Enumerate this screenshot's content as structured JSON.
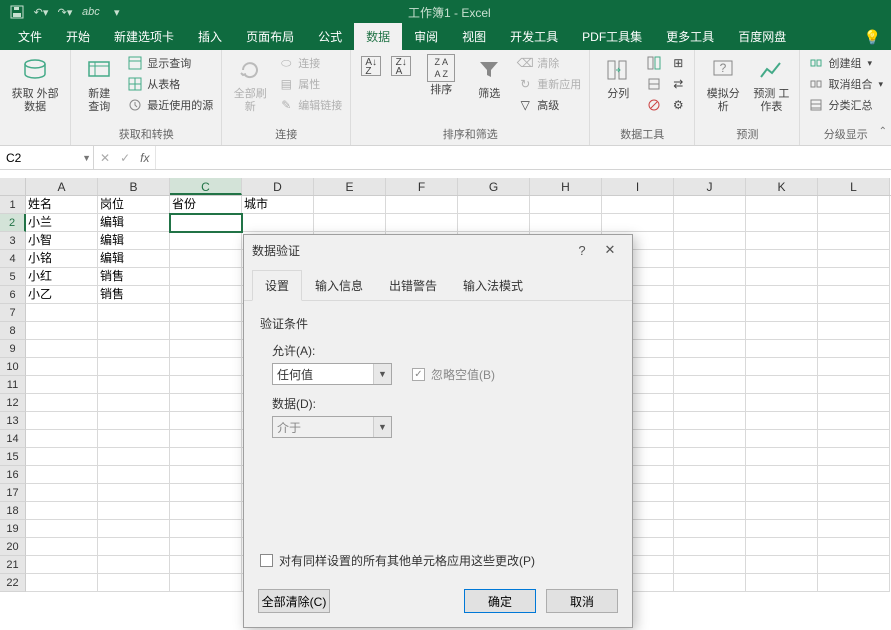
{
  "app": {
    "title": "工作簿1 - Excel"
  },
  "qat": {
    "save": "save-icon",
    "undo": "undo-icon",
    "redo": "redo-icon",
    "touch": "abc"
  },
  "tabs": {
    "items": [
      {
        "label": "文件"
      },
      {
        "label": "开始"
      },
      {
        "label": "新建选项卡"
      },
      {
        "label": "插入"
      },
      {
        "label": "页面布局"
      },
      {
        "label": "公式"
      },
      {
        "label": "数据"
      },
      {
        "label": "审阅"
      },
      {
        "label": "视图"
      },
      {
        "label": "开发工具"
      },
      {
        "label": "PDF工具集"
      },
      {
        "label": "更多工具"
      },
      {
        "label": "百度网盘"
      }
    ],
    "active_index": 6
  },
  "ribbon": {
    "g1": {
      "label": "获取\n外部数据"
    },
    "g2": {
      "label": "获取和转换",
      "newquery": "新建\n查询",
      "showq": "显示查询",
      "fromtable": "从表格",
      "recent": "最近使用的源"
    },
    "g3": {
      "label": "连接",
      "refresh": "全部刷新",
      "conn": "连接",
      "prop": "属性",
      "edit": "编辑链接"
    },
    "g4": {
      "label": "排序和筛选",
      "sort": "排序",
      "filter": "筛选",
      "clear": "清除",
      "reapply": "重新应用",
      "adv": "高级"
    },
    "g5": {
      "label": "数据工具",
      "textcol": "分列"
    },
    "g6": {
      "label": "预测",
      "whatif": "模拟分析",
      "forecast": "预测\n工作表"
    },
    "g7": {
      "label": "分级显示",
      "group": "创建组",
      "ungroup": "取消组合",
      "subtotal": "分类汇总"
    }
  },
  "namebox": "C2",
  "columns": [
    "A",
    "B",
    "C",
    "D",
    "E",
    "F",
    "G",
    "H",
    "I",
    "J",
    "K",
    "L"
  ],
  "active_col_index": 2,
  "active_row_index": 1,
  "data_rows": [
    [
      "姓名",
      "岗位",
      "省份",
      "城市",
      "",
      "",
      "",
      "",
      "",
      "",
      "",
      ""
    ],
    [
      "小兰",
      "编辑",
      "",
      "",
      "",
      "",
      "",
      "",
      "",
      "",
      "",
      ""
    ],
    [
      "小智",
      "编辑",
      "",
      "",
      "",
      "",
      "",
      "",
      "",
      "",
      "",
      ""
    ],
    [
      "小铭",
      "编辑",
      "",
      "",
      "",
      "",
      "",
      "",
      "",
      "",
      "",
      ""
    ],
    [
      "小红",
      "销售",
      "",
      "",
      "",
      "",
      "",
      "",
      "",
      "",
      "",
      ""
    ],
    [
      "小乙",
      "销售",
      "",
      "",
      "",
      "",
      "",
      "",
      "",
      "",
      "",
      ""
    ]
  ],
  "total_rows": 22,
  "dialog": {
    "title": "数据验证",
    "tabs": [
      {
        "label": "设置"
      },
      {
        "label": "输入信息"
      },
      {
        "label": "出错警告"
      },
      {
        "label": "输入法模式"
      }
    ],
    "active_tab": 0,
    "section": "验证条件",
    "allow_label": "允许(A):",
    "allow_value": "任何值",
    "ignore_blank": "忽略空值(B)",
    "data_label": "数据(D):",
    "data_value": "介于",
    "apply_all": "对有同样设置的所有其他单元格应用这些更改(P)",
    "clear": "全部清除(C)",
    "ok": "确定",
    "cancel": "取消"
  }
}
